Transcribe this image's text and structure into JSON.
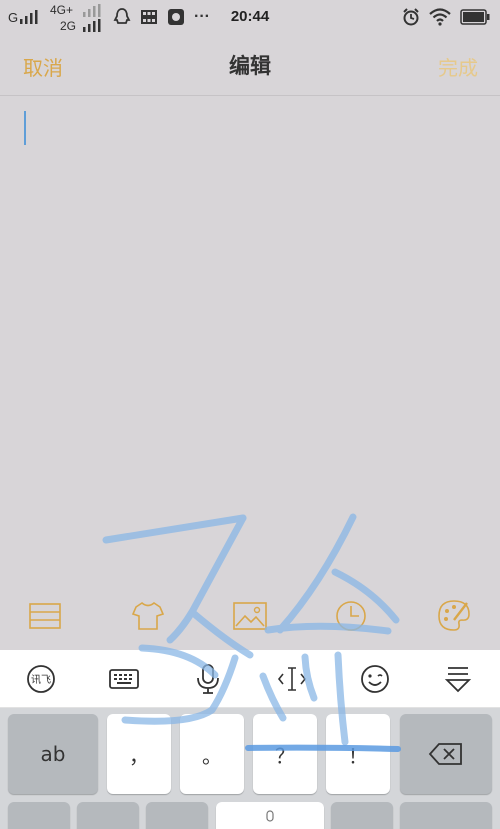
{
  "status_bar": {
    "carrier1": "G",
    "net_top": "4G+",
    "net_bottom": "2G",
    "more": "···",
    "time": "20:44",
    "icons_left": [
      "qq-icon",
      "grid-app-icon",
      "gallery-icon"
    ],
    "icons_right": [
      "alarm-icon",
      "wifi-icon",
      "battery-icon"
    ]
  },
  "header": {
    "cancel_label": "取消",
    "title": "编辑",
    "done_label": "完成",
    "accent_color": "#d9a74a"
  },
  "editor": {
    "content": "",
    "caret_color": "#5f9ed8"
  },
  "note_toolbar": {
    "items": [
      "list-icon",
      "shirt-icon",
      "image-icon",
      "clock-icon",
      "palette-icon"
    ]
  },
  "keyboard_toolbar": {
    "items": [
      "xunfei-logo-icon",
      "keyboard-icon",
      "microphone-icon",
      "cursor-move-icon",
      "emoji-icon",
      "hide-keyboard-icon"
    ]
  },
  "keyboard": {
    "row1": {
      "mode_key": "ab",
      "punct": [
        "，",
        "。",
        "？",
        "！"
      ],
      "delete": "backspace-icon"
    }
  }
}
